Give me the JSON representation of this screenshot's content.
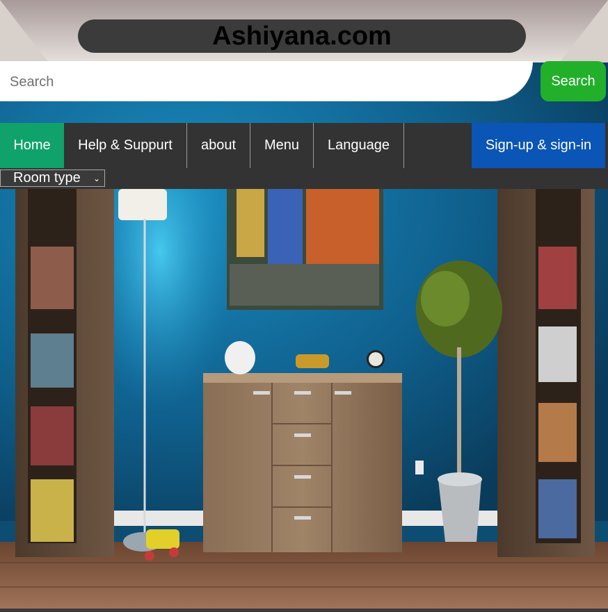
{
  "header": {
    "site_title": "Ashiyana.com"
  },
  "search": {
    "placeholder": "Search",
    "button_label": "Search"
  },
  "nav": {
    "items": [
      {
        "label": "Home",
        "active": true
      },
      {
        "label": "Help & Suppurt"
      },
      {
        "label": "about"
      },
      {
        "label": "Menu"
      },
      {
        "label": "Language"
      }
    ],
    "signup_label": "Sign-up & sign-in"
  },
  "room_type": {
    "selected": "Room type"
  },
  "colors": {
    "active_green": "#0fa36b",
    "search_green": "#22b02a",
    "signup_blue": "#0a55b5",
    "nav_bg": "#333333",
    "wall_blue": "#0e5a85"
  }
}
